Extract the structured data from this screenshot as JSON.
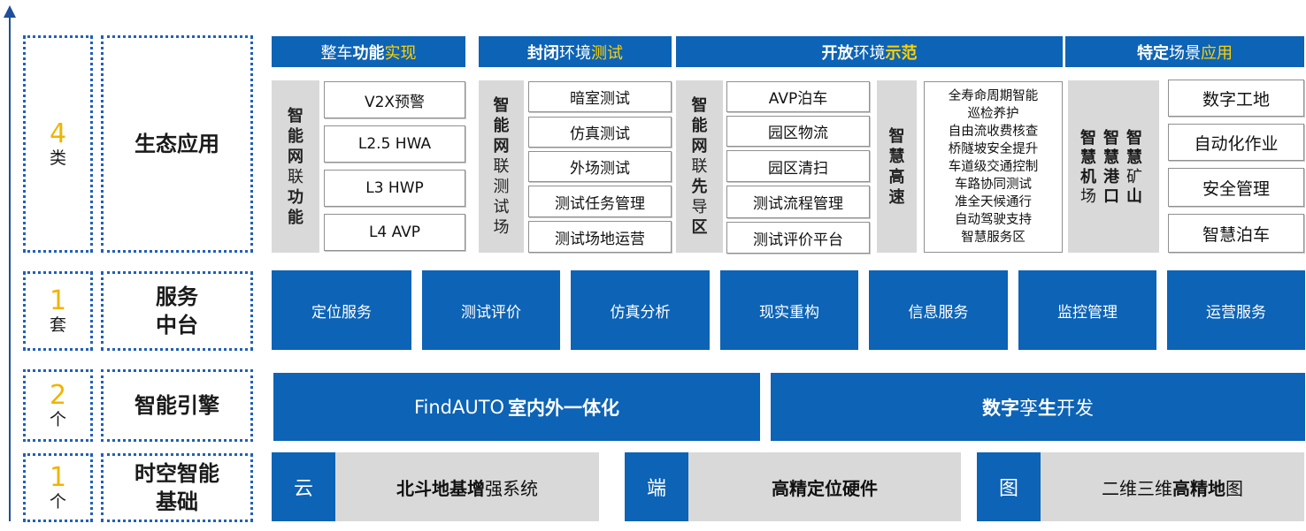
{
  "left": {
    "rows": [
      {
        "num": "4",
        "unit": "类",
        "label": "生态应用"
      },
      {
        "num": "1",
        "unit": "套",
        "label_lines": [
          "服务",
          "中台"
        ]
      },
      {
        "num": "2",
        "unit": "个",
        "label": "智能引擎"
      },
      {
        "num": "1",
        "unit": "个",
        "label_lines": [
          "时空智能",
          "基础"
        ]
      }
    ]
  },
  "headers": [
    {
      "part1": "整车",
      "part2": "功能",
      "part3": "实现"
    },
    {
      "part1": "封闭",
      "part2": "环境",
      "part3": "测试"
    },
    {
      "part1": "开放",
      "part2": "环境",
      "part3": "示范"
    },
    {
      "part1": "特定",
      "part2": "场景",
      "part3": "应用"
    }
  ],
  "col1": {
    "label_chars": [
      "智",
      "能",
      "网",
      "联",
      "功",
      "能"
    ],
    "items": [
      "V2X预警",
      "L2.5 HWA",
      "L3 HWP",
      "L4 AVP"
    ]
  },
  "col2": {
    "label_chars": [
      "智",
      "能",
      "网",
      "联",
      "测",
      "试",
      "场"
    ],
    "items": [
      "暗室测试",
      "仿真测试",
      "外场测试",
      "测试任务管理",
      "测试场地运营"
    ]
  },
  "col3": {
    "label_chars": [
      "智",
      "能",
      "网",
      "联",
      "先",
      "导",
      "区"
    ],
    "items": [
      "AVP泊车",
      "园区物流",
      "园区清扫",
      "测试流程管理",
      "测试评价平台"
    ],
    "highway_chars": [
      "智",
      "慧",
      "高",
      "速"
    ],
    "highway_items": [
      "全寿命周期智能",
      "巡检养护",
      "自由流收费核查",
      "桥隧坡安全提升",
      "车道级交通控制",
      "车路协同测试",
      "准全天候通行",
      "自动驾驶支持",
      "智慧服务区"
    ]
  },
  "col4": {
    "airport_chars": [
      "智",
      "慧",
      "机",
      "场"
    ],
    "port_chars": [
      "智",
      "慧",
      "港",
      "口"
    ],
    "mine_chars": [
      "智",
      "慧",
      "矿",
      "山"
    ],
    "items": [
      "数字工地",
      "自动化作业",
      "安全管理",
      "智慧泊车"
    ]
  },
  "services": [
    "定位服务",
    "测试评价",
    "仿真分析",
    "现实重构",
    "信息服务",
    "监控管理",
    "运营服务"
  ],
  "engines": [
    {
      "part1": "Find",
      "part2": "AUTO",
      "part3": "室内外一体化"
    },
    {
      "part1": "数字",
      "part2": "孪",
      "part3": "生",
      "part4": "开发"
    }
  ],
  "foundation": [
    {
      "tag": "云",
      "part1": "北斗地基增",
      "part2": "强系统"
    },
    {
      "tag": "端",
      "part1": "高精定位硬件",
      "part2": ""
    },
    {
      "tag": "图",
      "part1": "二维三维",
      "part2": "高精地",
      "part3": "图"
    }
  ],
  "colors": {
    "blue": "#0d63b5",
    "grey": "#d9d9d9",
    "yellow": "#ffd200",
    "dot_border": "#1f5fbf"
  }
}
